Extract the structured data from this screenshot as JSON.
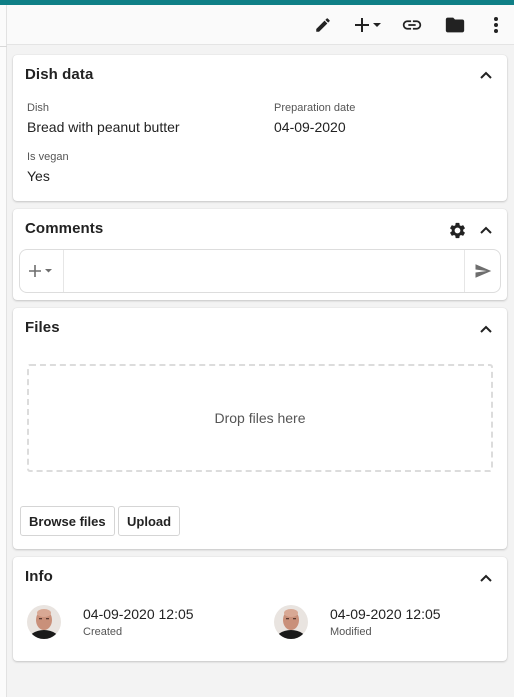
{
  "colors": {
    "accent": "#0f7f86",
    "icon": "#222222",
    "send": "#6e6e6e"
  },
  "toolbar": {
    "icons": [
      "pencil-icon",
      "plus-dropdown-icon",
      "link-icon",
      "folder-icon",
      "more-vertical-icon"
    ]
  },
  "dish_data": {
    "title": "Dish data",
    "fields": [
      {
        "label": "Dish",
        "value": "Bread with peanut butter"
      },
      {
        "label": "Preparation date",
        "value": "04-09-2020"
      },
      {
        "label": "Is vegan",
        "value": "Yes"
      }
    ]
  },
  "comments": {
    "title": "Comments",
    "input_value": "",
    "input_placeholder": ""
  },
  "files": {
    "title": "Files",
    "dropzone_text": "Drop files here",
    "browse_label": "Browse files",
    "upload_label": "Upload"
  },
  "info": {
    "title": "Info",
    "created": {
      "datetime": "04-09-2020 12:05",
      "label": "Created"
    },
    "modified": {
      "datetime": "04-09-2020 12:05",
      "label": "Modified"
    }
  }
}
